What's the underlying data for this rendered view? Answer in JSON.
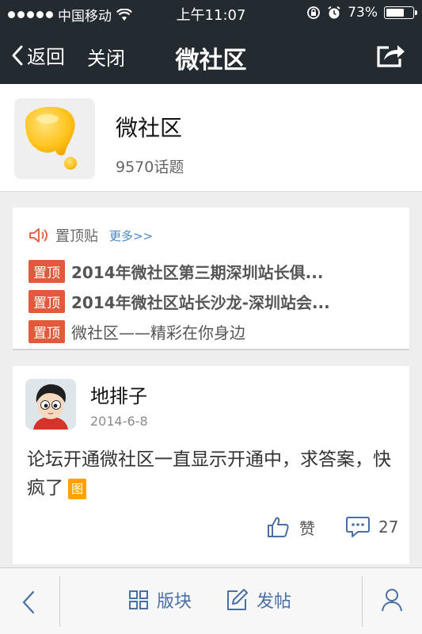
{
  "status_bar": {
    "carrier": "中国移动",
    "time": "上午11:07",
    "battery": "73%",
    "battery_level": 0.73
  },
  "nav": {
    "back_label": "返回",
    "close_label": "关闭",
    "title": "微社区"
  },
  "forum": {
    "name": "微社区",
    "topic_count": "9570话题"
  },
  "pinned": {
    "label": "置顶贴",
    "more": "更多>>",
    "badge": "置顶",
    "items": [
      {
        "text": "2014年微社区第三期深圳站长俱..."
      },
      {
        "text": "2014年微社区站长沙龙-深圳站会..."
      },
      {
        "text": "微社区——精彩在你身边"
      }
    ]
  },
  "post": {
    "author": "地排子",
    "date": "2014-6-8",
    "content": "论坛开通微社区一直显示开通中，求答案，快疯了",
    "image_tag": "图",
    "like_label": "赞",
    "comment_count": "27"
  },
  "bottom_bar": {
    "section_label": "版块",
    "post_label": "发帖"
  },
  "colors": {
    "nav_bg": "#232a30",
    "badge": "#e05a3b",
    "link": "#4a86c5",
    "icon_blue": "#4a6fa5",
    "image_tag": "#ffa200"
  }
}
